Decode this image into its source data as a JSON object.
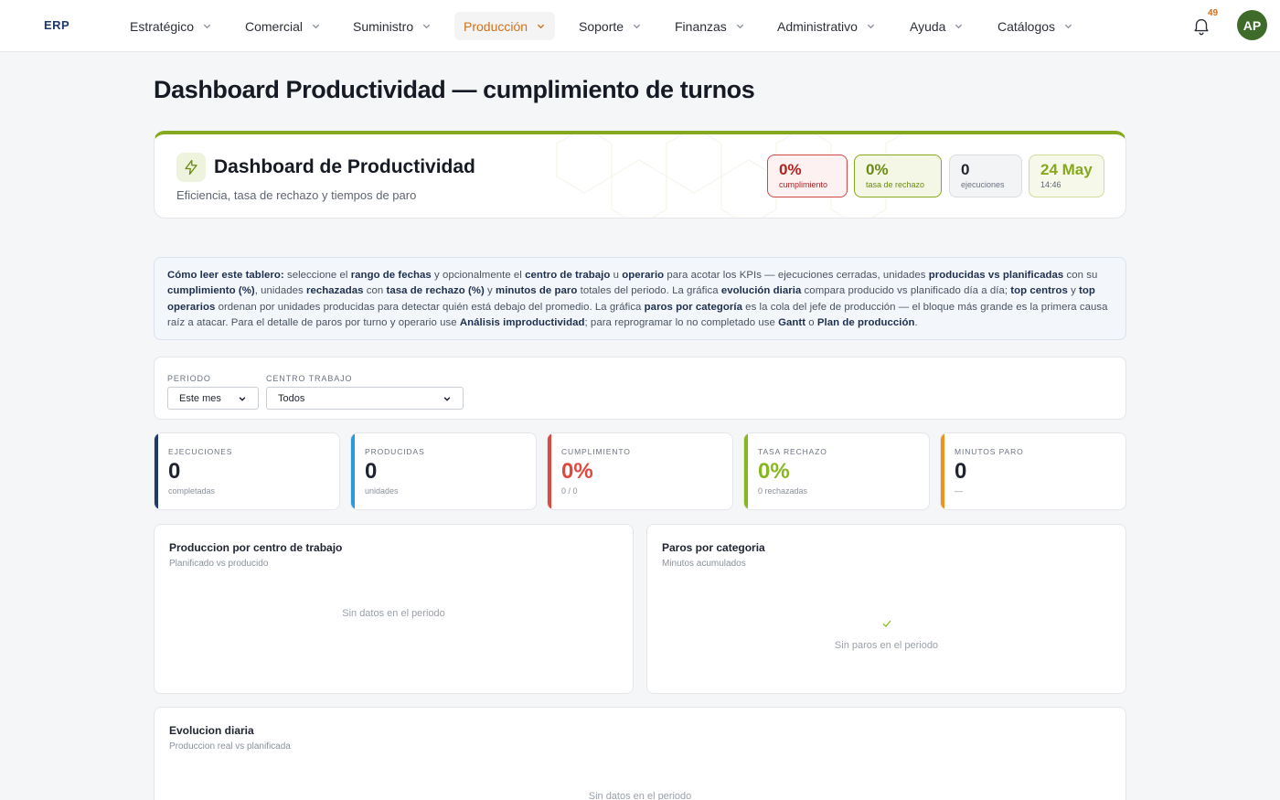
{
  "nav": {
    "brand": "ERP",
    "items": [
      {
        "label": "Estratégico"
      },
      {
        "label": "Comercial"
      },
      {
        "label": "Suministro"
      },
      {
        "label": "Producción"
      },
      {
        "label": "Soporte"
      },
      {
        "label": "Finanzas"
      },
      {
        "label": "Administrativo"
      },
      {
        "label": "Ayuda"
      },
      {
        "label": "Catálogos"
      }
    ],
    "active_item": "Producción",
    "notifications_count": "49",
    "avatar_initials": "AP"
  },
  "page": {
    "title": "Dashboard Productividad — cumplimiento de turnos"
  },
  "hero": {
    "title": "Dashboard de Productividad",
    "subtitle": "Eficiencia, tasa de rechazo y tiempos de paro",
    "pills": {
      "cumplimiento": {
        "value": "0%",
        "label": "cumplimiento"
      },
      "rechazo": {
        "value": "0%",
        "label": "tasa de rechazo"
      },
      "ejecuciones": {
        "value": "0",
        "label": "ejecuciones"
      },
      "fecha": {
        "value": "24 May",
        "label": "14:46"
      }
    }
  },
  "help": {
    "parts": [
      {
        "t": "Cómo leer este tablero:",
        "b": true
      },
      {
        "t": " seleccione el ",
        "b": false
      },
      {
        "t": "rango de fechas",
        "b": true
      },
      {
        "t": " y opcionalmente el ",
        "b": false
      },
      {
        "t": "centro de trabajo",
        "b": true
      },
      {
        "t": " u ",
        "b": false
      },
      {
        "t": "operario",
        "b": true
      },
      {
        "t": " para acotar los KPIs — ejecuciones cerradas, unidades ",
        "b": false
      },
      {
        "t": "producidas vs planificadas",
        "b": true
      },
      {
        "t": " con su ",
        "b": false
      },
      {
        "t": "cumplimiento (%)",
        "b": true
      },
      {
        "t": ", unidades ",
        "b": false
      },
      {
        "t": "rechazadas",
        "b": true
      },
      {
        "t": " con ",
        "b": false
      },
      {
        "t": "tasa de rechazo (%)",
        "b": true
      },
      {
        "t": " y ",
        "b": false
      },
      {
        "t": "minutos de paro",
        "b": true
      },
      {
        "t": " totales del periodo. La gráfica ",
        "b": false
      },
      {
        "t": "evolución diaria",
        "b": true
      },
      {
        "t": " compara producido vs planificado día a día; ",
        "b": false
      },
      {
        "t": "top centros",
        "b": true
      },
      {
        "t": " y ",
        "b": false
      },
      {
        "t": "top operarios",
        "b": true
      },
      {
        "t": " ordenan por unidades producidas para detectar quién está debajo del promedio. La gráfica ",
        "b": false
      },
      {
        "t": "paros por categoría",
        "b": true
      },
      {
        "t": " es la cola del jefe de producción — el bloque más grande es la primera causa raíz a atacar. Para el detalle de paros por turno y operario use ",
        "b": false
      },
      {
        "t": "Análisis improductividad",
        "b": true
      },
      {
        "t": "; para reprogramar lo no completado use ",
        "b": false
      },
      {
        "t": "Gantt",
        "b": true
      },
      {
        "t": " o ",
        "b": false
      },
      {
        "t": "Plan de producción",
        "b": true
      },
      {
        "t": ".",
        "b": false
      }
    ]
  },
  "filters": {
    "periodo": {
      "label": "PERIODO",
      "value": "Este mes"
    },
    "centro": {
      "label": "CENTRO TRABAJO",
      "value": "Todos"
    }
  },
  "kpis": [
    {
      "key": "EJECUCIONES",
      "value": "0",
      "sub": "completadas",
      "color": "#1e3a6b"
    },
    {
      "key": "PRODUCIDAS",
      "value": "0",
      "sub": "unidades",
      "color": "#2a9bd8"
    },
    {
      "key": "CUMPLIMIENTO",
      "value": "0%",
      "sub": "0 / 0",
      "color": "#e0483f"
    },
    {
      "key": "TASA RECHAZO",
      "value": "0%",
      "sub": "0 rechazadas",
      "color": "#86b81e"
    },
    {
      "key": "MINUTOS PARO",
      "value": "0",
      "sub": "—",
      "color": "#f0931c"
    }
  ],
  "panels": {
    "centro": {
      "title": "Produccion por centro de trabajo",
      "subtitle": "Planificado vs producido",
      "empty": "Sin datos en el periodo"
    },
    "paros": {
      "title": "Paros por categoria",
      "subtitle": "Minutos acumulados",
      "empty": "Sin paros en el periodo"
    },
    "evolucion": {
      "title": "Evolucion diaria",
      "subtitle": "Produccion real vs planificada",
      "empty": "Sin datos en el periodo"
    }
  },
  "colors": {
    "accent": "#d2701b",
    "brand": "#1e3a6b",
    "hero_border": "#86a81e"
  }
}
